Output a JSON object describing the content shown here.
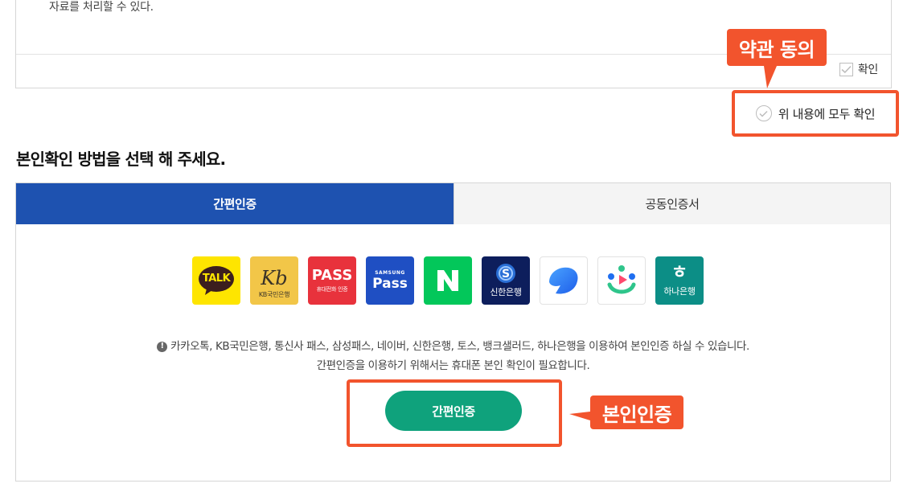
{
  "terms": {
    "body_text": "자료를 처리할 수 있다.",
    "confirm_label": "확인"
  },
  "agree_all": {
    "label": "위 내용에 모두 확인"
  },
  "annotations": {
    "terms_tag": "약관 동의",
    "verify_tag": "본인인증",
    "color": "#f2542d"
  },
  "section": {
    "title": "본인확인 방법을 선택 해 주세요."
  },
  "tabs": [
    {
      "label": "간편인증",
      "active": true
    },
    {
      "label": "공동인증서",
      "active": false
    }
  ],
  "providers": {
    "kakao": {
      "text": "TALK",
      "icon": "kakaotalk-icon"
    },
    "kb": {
      "logo": "Kb",
      "text": "KB국민은행",
      "icon": "kb-bank-icon"
    },
    "pass": {
      "logo": "PASS",
      "text": "휴대전화 인증",
      "icon": "pass-icon"
    },
    "samsung_pass": {
      "brand": "SAMSUNG",
      "logo": "Pass",
      "icon": "samsung-pass-icon"
    },
    "naver": {
      "logo": "N",
      "icon": "naver-icon"
    },
    "shinhan": {
      "logo": "S",
      "text": "신한은행",
      "icon": "shinhan-bank-icon"
    },
    "toss": {
      "icon": "toss-icon"
    },
    "banksalad": {
      "icon": "banksalad-icon"
    },
    "hana": {
      "logo": "ㅎ",
      "text": "하나은행",
      "icon": "hana-bank-icon"
    }
  },
  "info": {
    "line1": "카카오톡, KB국민은행, 통신사 패스, 삼성패스, 네이버, 신한은행, 토스, 뱅크샐러드, 하나은행을 이용하여 본인인증 하실 수 있습니다.",
    "line2": "간편인증을 이용하기 위해서는 휴대폰 본인 확인이 필요합니다."
  },
  "verify_button": {
    "label": "간편인증",
    "color": "#0fa27c"
  },
  "colors": {
    "tab_active": "#1e52b0",
    "tab_inactive": "#f4f4f4"
  }
}
